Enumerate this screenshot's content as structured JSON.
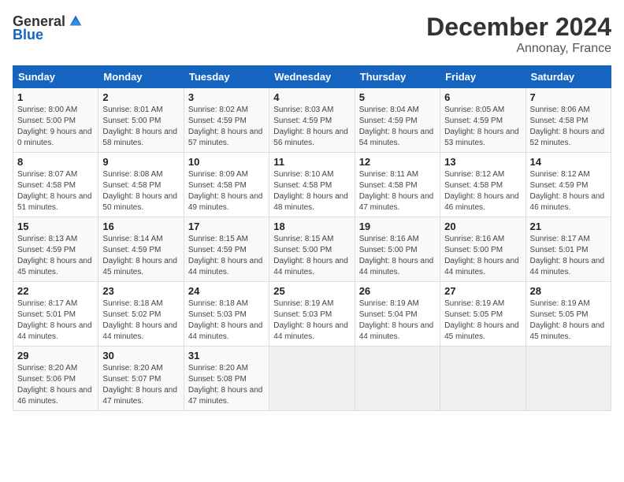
{
  "header": {
    "logo_general": "General",
    "logo_blue": "Blue",
    "month": "December 2024",
    "location": "Annonay, France"
  },
  "weekdays": [
    "Sunday",
    "Monday",
    "Tuesday",
    "Wednesday",
    "Thursday",
    "Friday",
    "Saturday"
  ],
  "weeks": [
    [
      {
        "day": "1",
        "sunrise": "Sunrise: 8:00 AM",
        "sunset": "Sunset: 5:00 PM",
        "daylight": "Daylight: 9 hours and 0 minutes."
      },
      {
        "day": "2",
        "sunrise": "Sunrise: 8:01 AM",
        "sunset": "Sunset: 5:00 PM",
        "daylight": "Daylight: 8 hours and 58 minutes."
      },
      {
        "day": "3",
        "sunrise": "Sunrise: 8:02 AM",
        "sunset": "Sunset: 4:59 PM",
        "daylight": "Daylight: 8 hours and 57 minutes."
      },
      {
        "day": "4",
        "sunrise": "Sunrise: 8:03 AM",
        "sunset": "Sunset: 4:59 PM",
        "daylight": "Daylight: 8 hours and 56 minutes."
      },
      {
        "day": "5",
        "sunrise": "Sunrise: 8:04 AM",
        "sunset": "Sunset: 4:59 PM",
        "daylight": "Daylight: 8 hours and 54 minutes."
      },
      {
        "day": "6",
        "sunrise": "Sunrise: 8:05 AM",
        "sunset": "Sunset: 4:59 PM",
        "daylight": "Daylight: 8 hours and 53 minutes."
      },
      {
        "day": "7",
        "sunrise": "Sunrise: 8:06 AM",
        "sunset": "Sunset: 4:58 PM",
        "daylight": "Daylight: 8 hours and 52 minutes."
      }
    ],
    [
      {
        "day": "8",
        "sunrise": "Sunrise: 8:07 AM",
        "sunset": "Sunset: 4:58 PM",
        "daylight": "Daylight: 8 hours and 51 minutes."
      },
      {
        "day": "9",
        "sunrise": "Sunrise: 8:08 AM",
        "sunset": "Sunset: 4:58 PM",
        "daylight": "Daylight: 8 hours and 50 minutes."
      },
      {
        "day": "10",
        "sunrise": "Sunrise: 8:09 AM",
        "sunset": "Sunset: 4:58 PM",
        "daylight": "Daylight: 8 hours and 49 minutes."
      },
      {
        "day": "11",
        "sunrise": "Sunrise: 8:10 AM",
        "sunset": "Sunset: 4:58 PM",
        "daylight": "Daylight: 8 hours and 48 minutes."
      },
      {
        "day": "12",
        "sunrise": "Sunrise: 8:11 AM",
        "sunset": "Sunset: 4:58 PM",
        "daylight": "Daylight: 8 hours and 47 minutes."
      },
      {
        "day": "13",
        "sunrise": "Sunrise: 8:12 AM",
        "sunset": "Sunset: 4:58 PM",
        "daylight": "Daylight: 8 hours and 46 minutes."
      },
      {
        "day": "14",
        "sunrise": "Sunrise: 8:12 AM",
        "sunset": "Sunset: 4:59 PM",
        "daylight": "Daylight: 8 hours and 46 minutes."
      }
    ],
    [
      {
        "day": "15",
        "sunrise": "Sunrise: 8:13 AM",
        "sunset": "Sunset: 4:59 PM",
        "daylight": "Daylight: 8 hours and 45 minutes."
      },
      {
        "day": "16",
        "sunrise": "Sunrise: 8:14 AM",
        "sunset": "Sunset: 4:59 PM",
        "daylight": "Daylight: 8 hours and 45 minutes."
      },
      {
        "day": "17",
        "sunrise": "Sunrise: 8:15 AM",
        "sunset": "Sunset: 4:59 PM",
        "daylight": "Daylight: 8 hours and 44 minutes."
      },
      {
        "day": "18",
        "sunrise": "Sunrise: 8:15 AM",
        "sunset": "Sunset: 5:00 PM",
        "daylight": "Daylight: 8 hours and 44 minutes."
      },
      {
        "day": "19",
        "sunrise": "Sunrise: 8:16 AM",
        "sunset": "Sunset: 5:00 PM",
        "daylight": "Daylight: 8 hours and 44 minutes."
      },
      {
        "day": "20",
        "sunrise": "Sunrise: 8:16 AM",
        "sunset": "Sunset: 5:00 PM",
        "daylight": "Daylight: 8 hours and 44 minutes."
      },
      {
        "day": "21",
        "sunrise": "Sunrise: 8:17 AM",
        "sunset": "Sunset: 5:01 PM",
        "daylight": "Daylight: 8 hours and 44 minutes."
      }
    ],
    [
      {
        "day": "22",
        "sunrise": "Sunrise: 8:17 AM",
        "sunset": "Sunset: 5:01 PM",
        "daylight": "Daylight: 8 hours and 44 minutes."
      },
      {
        "day": "23",
        "sunrise": "Sunrise: 8:18 AM",
        "sunset": "Sunset: 5:02 PM",
        "daylight": "Daylight: 8 hours and 44 minutes."
      },
      {
        "day": "24",
        "sunrise": "Sunrise: 8:18 AM",
        "sunset": "Sunset: 5:03 PM",
        "daylight": "Daylight: 8 hours and 44 minutes."
      },
      {
        "day": "25",
        "sunrise": "Sunrise: 8:19 AM",
        "sunset": "Sunset: 5:03 PM",
        "daylight": "Daylight: 8 hours and 44 minutes."
      },
      {
        "day": "26",
        "sunrise": "Sunrise: 8:19 AM",
        "sunset": "Sunset: 5:04 PM",
        "daylight": "Daylight: 8 hours and 44 minutes."
      },
      {
        "day": "27",
        "sunrise": "Sunrise: 8:19 AM",
        "sunset": "Sunset: 5:05 PM",
        "daylight": "Daylight: 8 hours and 45 minutes."
      },
      {
        "day": "28",
        "sunrise": "Sunrise: 8:19 AM",
        "sunset": "Sunset: 5:05 PM",
        "daylight": "Daylight: 8 hours and 45 minutes."
      }
    ],
    [
      {
        "day": "29",
        "sunrise": "Sunrise: 8:20 AM",
        "sunset": "Sunset: 5:06 PM",
        "daylight": "Daylight: 8 hours and 46 minutes."
      },
      {
        "day": "30",
        "sunrise": "Sunrise: 8:20 AM",
        "sunset": "Sunset: 5:07 PM",
        "daylight": "Daylight: 8 hours and 47 minutes."
      },
      {
        "day": "31",
        "sunrise": "Sunrise: 8:20 AM",
        "sunset": "Sunset: 5:08 PM",
        "daylight": "Daylight: 8 hours and 47 minutes."
      },
      null,
      null,
      null,
      null
    ]
  ]
}
